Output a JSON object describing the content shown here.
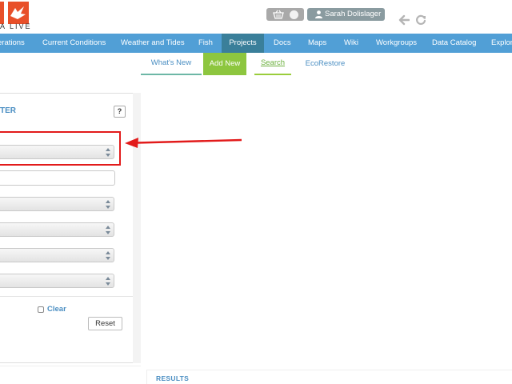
{
  "header": {
    "logo_text": "A LIVE",
    "user_name": "Sarah Dolislager"
  },
  "nav": {
    "items": [
      {
        "label": "erations"
      },
      {
        "label": "Current Conditions"
      },
      {
        "label": "Weather and Tides"
      },
      {
        "label": "Fish"
      },
      {
        "label": "Projects"
      },
      {
        "label": "Docs"
      },
      {
        "label": "Maps"
      },
      {
        "label": "Wiki"
      },
      {
        "label": "Workgroups"
      },
      {
        "label": "Data Catalog"
      },
      {
        "label": "Explor"
      }
    ],
    "active": "Projects"
  },
  "subnav": {
    "whats_new": "What's New",
    "add_new": "Add New",
    "search": "Search",
    "ecorestore": "EcoRestore"
  },
  "filter": {
    "title": "TER",
    "help": "?",
    "clear_label": "Clear",
    "reset_label": "Reset"
  },
  "results": {
    "label": "RESULTS"
  },
  "colors": {
    "nav_bg": "#519fd6",
    "nav_active": "#3a7f9a",
    "add_new_bg": "#8dc63f",
    "link_blue": "#4a8ec2",
    "highlight_red": "#e21b1b"
  }
}
